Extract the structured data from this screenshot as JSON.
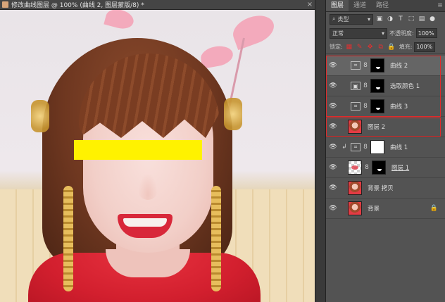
{
  "document": {
    "tab_title": "修改曲线图层 @ 100% (曲线 2, 图层蒙版/8) *",
    "close_glyph": "×"
  },
  "panel": {
    "tabs": [
      {
        "label": "图层",
        "active": true
      },
      {
        "label": "通道",
        "active": false
      },
      {
        "label": "路径",
        "active": false
      }
    ],
    "menu_glyph": "≡",
    "filter": {
      "search_glyph": "⌕",
      "kind_label": "类型",
      "dropdown_glyph": "▾",
      "icons": [
        "pixel-filter-icon",
        "adjustment-filter-icon",
        "type-filter-icon",
        "shape-filter-icon",
        "smart-object-filter-icon"
      ]
    },
    "blend_mode": {
      "value": "正常",
      "dropdown_glyph": "▾"
    },
    "opacity": {
      "label": "不透明度:",
      "value": "100%"
    },
    "lock": {
      "label": "锁定:",
      "glyphs": [
        "▦",
        "✎",
        "✥",
        "⧉",
        "🔒"
      ]
    },
    "fill": {
      "label": "填充:",
      "value": "100%"
    },
    "layers": [
      {
        "name": "曲线 2",
        "type": "adjustment",
        "adj_glyph": "⌗",
        "mask": "black",
        "selected": true,
        "clipped": false
      },
      {
        "name": "选取颜色 1",
        "type": "adjustment",
        "adj_glyph": "▣",
        "mask": "black",
        "selected": false,
        "clipped": false
      },
      {
        "name": "曲线 3",
        "type": "adjustment",
        "adj_glyph": "⌗",
        "mask": "black",
        "selected": false,
        "clipped": false
      },
      {
        "name": "图层 2",
        "type": "pixel",
        "thumb": "photo",
        "selected": false,
        "clipped": false
      },
      {
        "name": "曲线 1",
        "type": "adjustment",
        "adj_glyph": "⌗",
        "mask": "white",
        "selected": false,
        "clipped": true
      },
      {
        "name": "图层 1",
        "type": "pixel",
        "thumb": "checker",
        "mask": "black",
        "selected": false,
        "clipped": false,
        "underline": true
      },
      {
        "name": "背景 拷贝",
        "type": "pixel",
        "thumb": "photo",
        "selected": false,
        "clipped": false
      },
      {
        "name": "背景",
        "type": "pixel",
        "thumb": "photo",
        "selected": false,
        "clipped": false,
        "locked": true
      }
    ],
    "glyphs": {
      "eye": "👁",
      "chain": "8",
      "clip": "↲",
      "lock": "🔒"
    }
  },
  "colors": {
    "annotation_frame": "#e02a2a",
    "redaction": "#fff200"
  }
}
